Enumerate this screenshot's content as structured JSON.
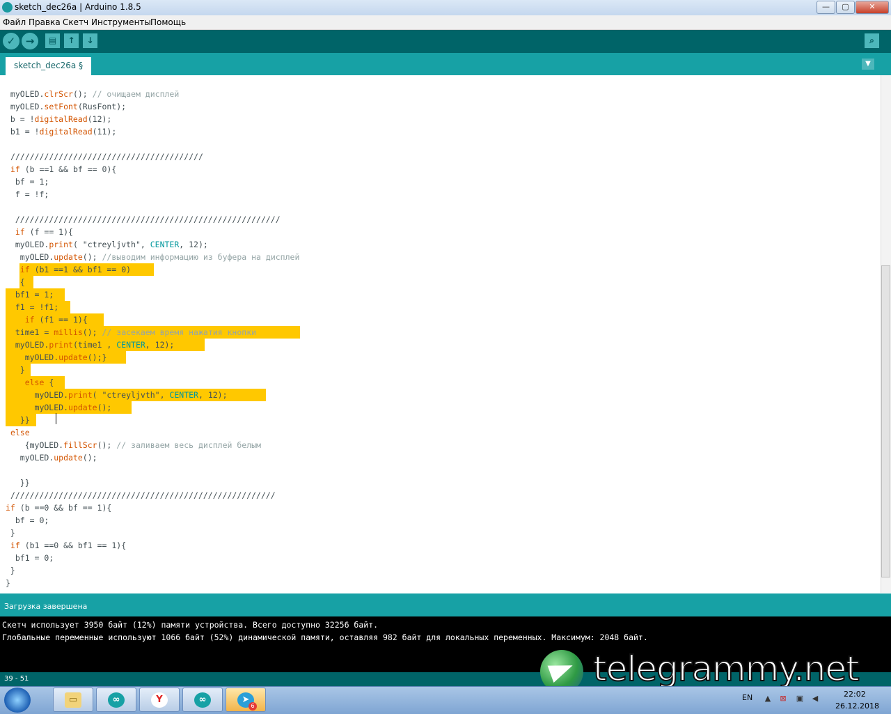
{
  "window": {
    "title": "sketch_dec26a | Arduino 1.8.5",
    "controls": {
      "minimize": "—",
      "maximize": "▢",
      "close": "✕"
    }
  },
  "menu": [
    "Файл",
    "Правка",
    "Скетч",
    "Инструменты",
    "Помощь"
  ],
  "toolbar": {
    "verify_icon": "✓",
    "upload_icon": "→",
    "new_icon": "▤",
    "open_icon": "↑",
    "save_icon": "↓",
    "serial_icon": "⌕"
  },
  "tabs": {
    "active": "sketch_dec26a §",
    "menu_icon": "▼"
  },
  "editor": {
    "lines": [
      " myOLED.clrScr(); // очищаем дисплей",
      " myOLED.setFont(RusFont);",
      " b = !digitalRead(12);",
      " b1 = !digitalRead(11);",
      "",
      " ////////////////////////////////////////",
      " if (b ==1 && bf == 0){",
      "  bf = 1;",
      "  f = !f;",
      "",
      "  ///////////////////////////////////////////////////////",
      "  if (f == 1){",
      "  myOLED.print( \"ctreyljvth\", CENTER, 12);",
      "   myOLED.update(); //выводим информацию из буфера на дисплей",
      "   if (b1 ==1 && bf1 == 0)",
      "   {",
      "  bf1 = 1;",
      "  f1 = !f1;",
      "    if (f1 == 1){",
      "  time1 = millis(); // засекаем время нажатия кнопки",
      "  myOLED.print(time1 , CENTER, 12);",
      "    myOLED.update();}",
      "   }",
      "    else {",
      "      myOLED.print( \"ctreyljvth\", CENTER, 12);",
      "      myOLED.update();",
      "   }}",
      " else",
      "    {myOLED.fillScr(); // заливаем весь дисплей белым",
      "   myOLED.update();",
      "",
      "   }}",
      " ///////////////////////////////////////////////////////",
      "if (b ==0 && bf == 1){",
      "  bf = 0;",
      " }",
      " if (b1 ==0 && bf1 == 1){",
      "  bf1 = 0;",
      " }",
      "}"
    ],
    "highlight_color": "#ffc800",
    "keyword_color": "#d35400",
    "constant_color": "#00979c",
    "comment_color": "#95a5a6"
  },
  "status": {
    "message": "Загрузка завершена"
  },
  "console": {
    "lines": [
      "Скетч использует 3950 байт (12%) памяти устройства. Всего доступно 32256 байт.",
      "Глобальные переменные используют 1066 байт (52%) динамической памяти, оставляя 982 байт для локальных переменных. Максимум: 2048 байт."
    ]
  },
  "footer": {
    "cursor_position": "39 - 51"
  },
  "watermark": {
    "text": "telegrammy.net"
  },
  "taskbar": {
    "apps": [
      {
        "name": "explorer-icon",
        "glyph": "▭"
      },
      {
        "name": "arduino-icon",
        "glyph": "∞"
      },
      {
        "name": "yandex-browser-icon",
        "glyph": "Y"
      },
      {
        "name": "arduino-icon-2",
        "glyph": "∞"
      },
      {
        "name": "telegram-icon",
        "glyph": "➤",
        "badge": "6"
      }
    ],
    "language": "EN",
    "time": "22:02",
    "date": "26.12.2018"
  }
}
